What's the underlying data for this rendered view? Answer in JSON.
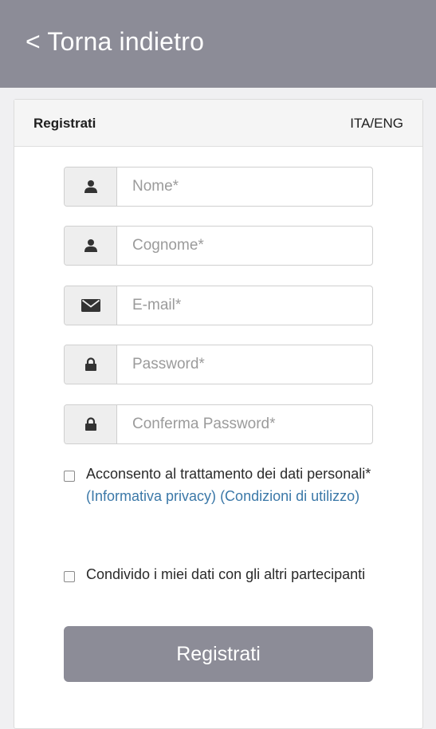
{
  "topbar": {
    "back_label": "< Torna indietro"
  },
  "card": {
    "title": "Registrati",
    "lang_switch": "ITA/ENG"
  },
  "form": {
    "fields": [
      {
        "placeholder": "Nome*",
        "value": "",
        "icon": "user-icon"
      },
      {
        "placeholder": "Cognome*",
        "value": "",
        "icon": "user-icon"
      },
      {
        "placeholder": "E-mail*",
        "value": "",
        "icon": "envelope-icon"
      },
      {
        "placeholder": "Password*",
        "value": "",
        "icon": "lock-icon"
      },
      {
        "placeholder": "Conferma Password*",
        "value": "",
        "icon": "lock-icon"
      }
    ],
    "consent": {
      "text": "Acconsento al trattamento dei dati personali*",
      "privacy_link": "(Informativa privacy)",
      "terms_link": "(Condizioni di utilizzo)",
      "checked": false
    },
    "share": {
      "text": "Condivido i miei dati con gli altri partecipanti",
      "checked": false
    },
    "submit_label": "Registrati"
  },
  "colors": {
    "header_bg": "#8c8c97",
    "button_bg": "#8c8c97",
    "link": "#3b78a8"
  }
}
